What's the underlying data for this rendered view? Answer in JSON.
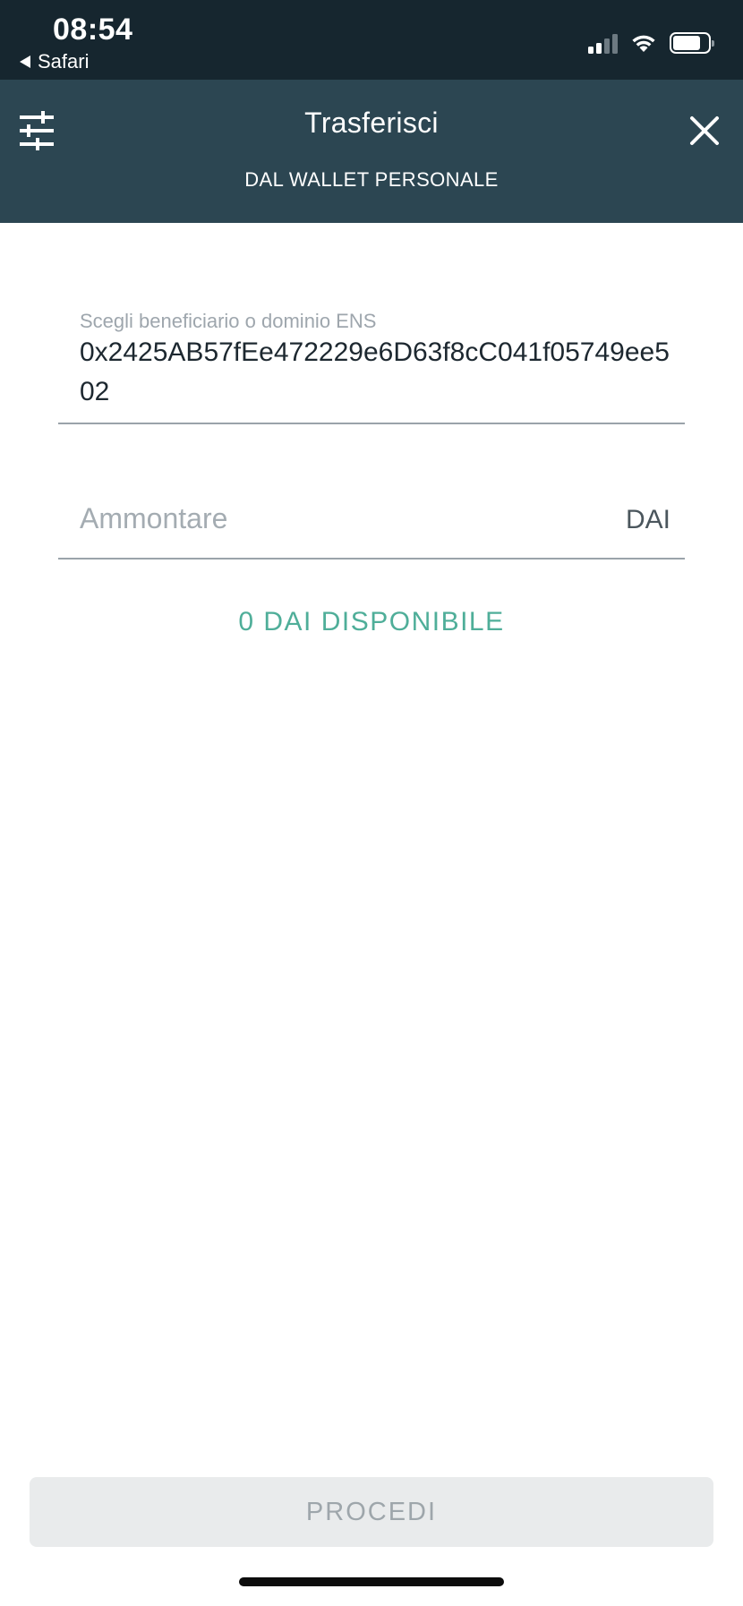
{
  "status_bar": {
    "time": "08:54",
    "back_app": "Safari",
    "icons": [
      "cellular-signal-icon",
      "wifi-icon",
      "battery-icon"
    ]
  },
  "header": {
    "title": "Trasferisci",
    "subtitle": "DAL WALLET PERSONALE",
    "left_icon": "sliders-icon",
    "right_icon": "close-icon"
  },
  "form": {
    "recipient_label": "Scegli beneficiario o dominio ENS",
    "recipient_value": "0x2425AB57fEe472229e6D63f8cC041f05749ee502",
    "amount_placeholder": "Ammontare",
    "amount_value": "",
    "currency": "DAI",
    "available": "0 DAI DISPONIBILE"
  },
  "footer": {
    "proceed_label": "PROCEDI"
  },
  "colors": {
    "status_bar_bg": "#16262f",
    "header_bg": "#2c4652",
    "accent_green": "#4fae99",
    "disabled_button_bg": "#e9ebec"
  }
}
